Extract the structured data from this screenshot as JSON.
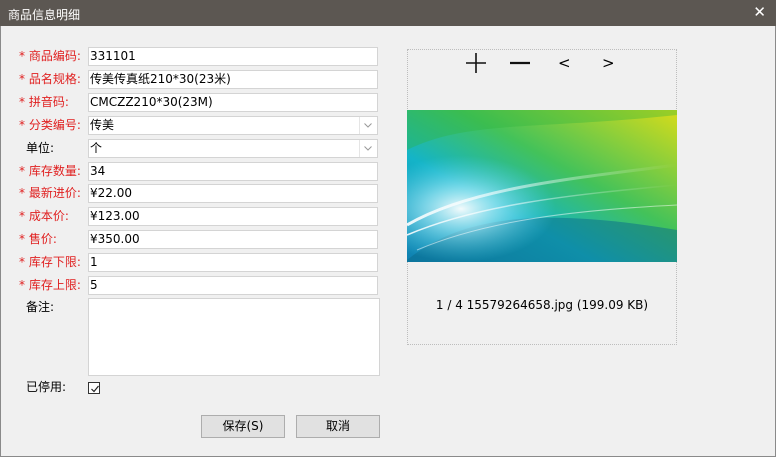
{
  "window": {
    "title": "商品信息明细",
    "close_glyph": "✕"
  },
  "form": {
    "required_mark": "*",
    "code": {
      "label": "商品编码:",
      "value": "331101"
    },
    "name_spec": {
      "label": "品名规格:",
      "value": "传美传真纸210*30(23米)"
    },
    "pinyin": {
      "label": "拼音码:",
      "value": "CMCZZ210*30(23M)"
    },
    "category": {
      "label": "分类编号:",
      "value": "传美"
    },
    "unit": {
      "label": "单位:",
      "value": "个"
    },
    "stock_qty": {
      "label": "库存数量:",
      "value": "34"
    },
    "latest_price": {
      "label": "最新进价:",
      "value": "¥22.00"
    },
    "cost_price": {
      "label": "成本价:",
      "value": "¥123.00"
    },
    "sale_price": {
      "label": "售价:",
      "value": "¥350.00"
    },
    "stock_min": {
      "label": "库存下限:",
      "value": "1"
    },
    "stock_max": {
      "label": "库存上限:",
      "value": "5"
    },
    "remark": {
      "label": "备注:",
      "value": ""
    },
    "disabled": {
      "label": "已停用:",
      "checked": true
    }
  },
  "buttons": {
    "save": "保存(S)",
    "cancel": "取消"
  },
  "viewer": {
    "tools": {
      "zoom_in": "+",
      "zoom_out": "−",
      "prev": "<",
      "next": ">"
    },
    "caption": "1 / 4 15579264658.jpg (199.09 KB)"
  }
}
